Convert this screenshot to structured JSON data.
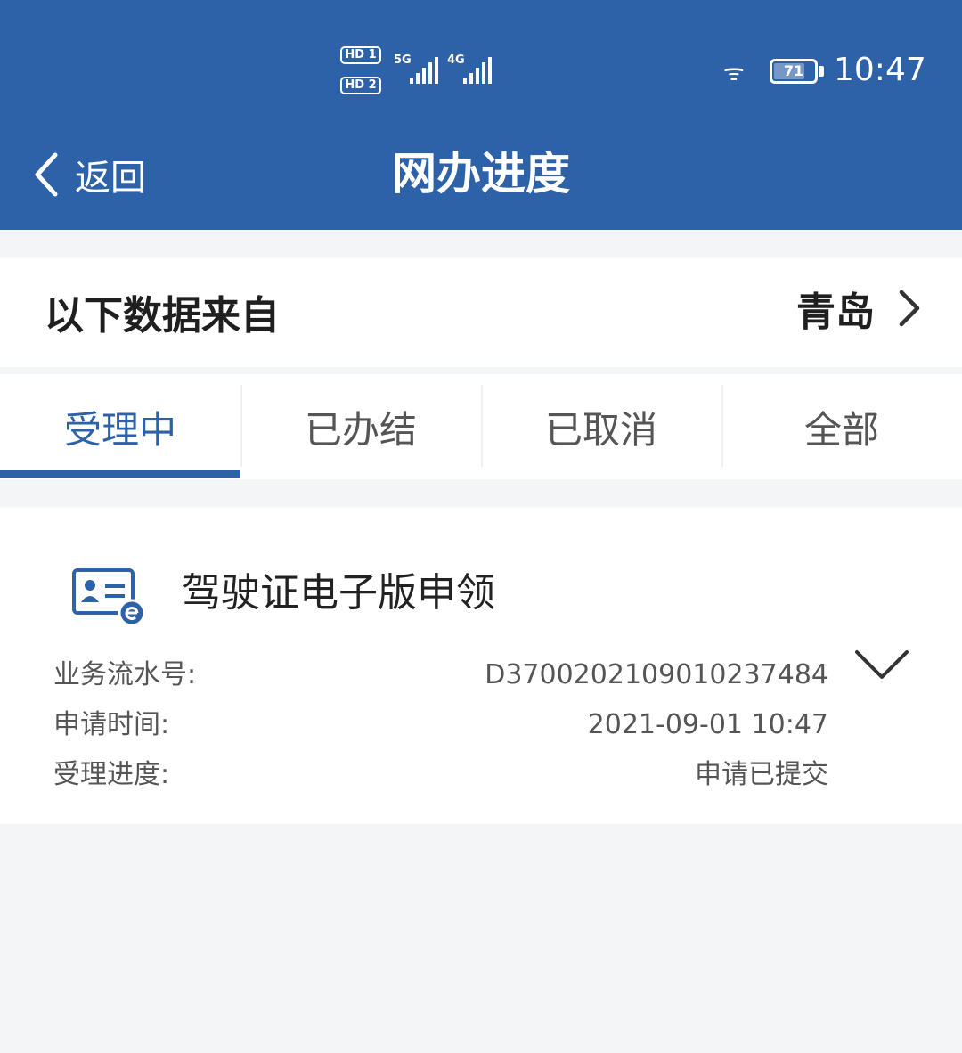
{
  "status_bar": {
    "sim1_label": "HD 1",
    "sim2_label": "HD 2",
    "network1": "5G",
    "network2": "4G",
    "battery_percent": "71",
    "time": "10:47"
  },
  "header": {
    "back_label": "返回",
    "title": "网办进度"
  },
  "data_source": {
    "label": "以下数据来自",
    "city": "青岛"
  },
  "tabs": [
    {
      "label": "受理中",
      "active": true
    },
    {
      "label": "已办结",
      "active": false
    },
    {
      "label": "已取消",
      "active": false
    },
    {
      "label": "全部",
      "active": false
    }
  ],
  "records": [
    {
      "title": "驾驶证电子版申领",
      "serial_label": "业务流水号:",
      "serial_value": "D37002021090102374​84",
      "time_label": "申请时间:",
      "time_value": "2021-09-01 10:47",
      "progress_label": "受理进度:",
      "progress_value": "申请已提交"
    }
  ],
  "colors": {
    "brand": "#2d62a8",
    "background": "#f4f5f7"
  },
  "icons": {
    "back": "chevron-left-icon",
    "city_select": "chevron-right-icon",
    "record": "id-card-icon",
    "expand": "chevron-down-icon"
  }
}
